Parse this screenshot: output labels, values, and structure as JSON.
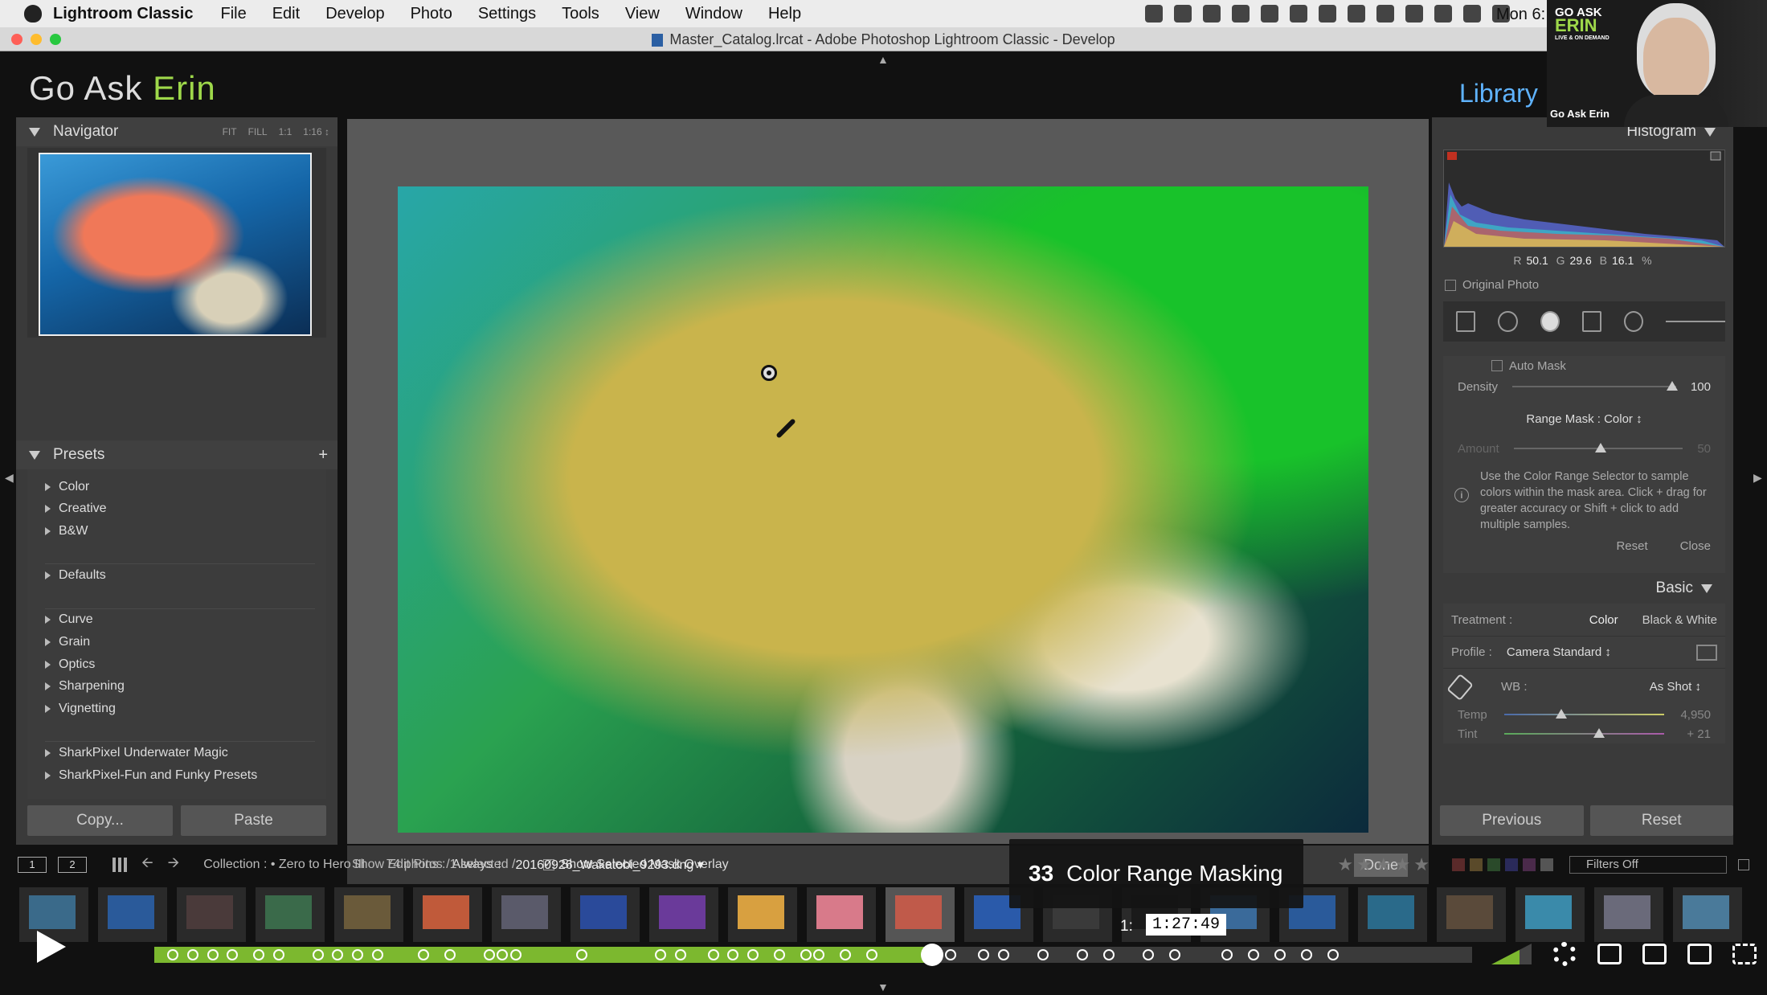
{
  "menubar": {
    "app_name": "Lightroom Classic",
    "items": [
      "File",
      "Edit",
      "Develop",
      "Photo",
      "Settings",
      "Tools",
      "View",
      "Window",
      "Help"
    ],
    "clock": "Mon 6:"
  },
  "window": {
    "title": "Master_Catalog.lrcat - Adobe Photoshop Lightroom Classic - Develop"
  },
  "identity": {
    "first": "Go Ask",
    "second": "Erin"
  },
  "module": {
    "label": "Library"
  },
  "navigator": {
    "title": "Navigator",
    "zoom": [
      "FIT",
      "FILL",
      "1:1",
      "1:16 ↕"
    ]
  },
  "presets": {
    "title": "Presets",
    "add": "+",
    "groups": [
      [
        "Color",
        "Creative",
        "B&W"
      ],
      [
        "Defaults"
      ],
      [
        "Curve",
        "Grain",
        "Optics",
        "Sharpening",
        "Vignetting"
      ],
      [
        "SharkPixel Underwater Magic",
        "SharkPixel-Fun and Funky Presets"
      ]
    ]
  },
  "left_buttons": {
    "copy": "Copy...",
    "paste": "Paste"
  },
  "center_toolbar": {
    "edit_pins_label": "Show Edit Pins :",
    "edit_pins_value": "Always ↕",
    "mask_overlay": "Show Selected Mask Overlay",
    "done": "Done"
  },
  "histogram": {
    "title": "Histogram",
    "r_label": "R",
    "r": "50.1",
    "g_label": "G",
    "g": "29.6",
    "b_label": "B",
    "b": "16.1",
    "pct": "%",
    "original_photo": "Original Photo"
  },
  "mask_panel": {
    "auto_mask": "Auto Mask",
    "density_label": "Density",
    "density_value": "100",
    "range_mask": "Range Mask : Color ↕",
    "amount_label": "Amount",
    "amount_value": "50",
    "info": "Use the Color Range Selector to sample colors within the mask area. Click + drag for greater accuracy or Shift + click to add multiple samples.",
    "reset": "Reset",
    "close": "Close"
  },
  "basic": {
    "title": "Basic",
    "treatment_label": "Treatment :",
    "treatment_color": "Color",
    "treatment_bw": "Black & White",
    "profile_label": "Profile :",
    "profile_value": "Camera Standard ↕",
    "wb_label": "WB :",
    "wb_value": "As Shot ↕",
    "temp_label": "Temp",
    "temp_value": "4,950",
    "temp_level": 0.32,
    "tint_label": "Tint",
    "tint_value": "+ 21",
    "tint_level": 0.56
  },
  "right_buttons": {
    "previous": "Previous",
    "reset": "Reset"
  },
  "filmstrip_bar": {
    "page1": "1",
    "page2": "2",
    "collection": "Collection : • Zero to Hero III",
    "count": "74 photos /1 selected /",
    "filename": "20160926_Wakatobi_9293.dng ▾",
    "stars": "★★★★★",
    "filters": "Filters Off"
  },
  "chapter": {
    "number": "33",
    "title": "Color Range Masking"
  },
  "video": {
    "time_prefix": "1:",
    "time": "1:27:49",
    "progress": 0.59
  },
  "webcam": {
    "brand_top": "GO ASK",
    "brand_big": "ERIN",
    "brand_sub": "LIVE & ON DEMAND",
    "name": "Go Ask Erin"
  },
  "colors": {
    "accent_green": "#7cb82f",
    "module_blue": "#5fb3ff",
    "brand_green": "#9ed84a"
  }
}
